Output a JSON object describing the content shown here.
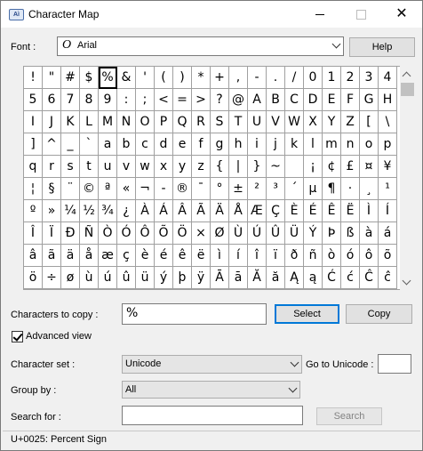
{
  "window": {
    "title": "Character Map",
    "icon": "character-map-app-icon",
    "icon_text": "Aì",
    "close_glyph": "✕"
  },
  "font": {
    "label": "Font :",
    "value": "Arial",
    "icon_glyph": "O"
  },
  "buttons": {
    "help": "Help",
    "select": "Select",
    "copy": "Copy",
    "search": "Search"
  },
  "characters": [
    "!",
    "\"",
    "#",
    "$",
    "%",
    "&",
    "'",
    "(",
    ")",
    "*",
    "+",
    ",",
    "-",
    ".",
    "/",
    "0",
    "1",
    "2",
    "3",
    "4",
    "5",
    "6",
    "7",
    "8",
    "9",
    ":",
    ";",
    "<",
    "=",
    ">",
    "?",
    "@",
    "A",
    "B",
    "C",
    "D",
    "E",
    "F",
    "G",
    "H",
    "I",
    "J",
    "K",
    "L",
    "M",
    "N",
    "O",
    "P",
    "Q",
    "R",
    "S",
    "T",
    "U",
    "V",
    "W",
    "X",
    "Y",
    "Z",
    "[",
    "\\",
    "]",
    "^",
    "_",
    "`",
    "a",
    "b",
    "c",
    "d",
    "e",
    "f",
    "g",
    "h",
    "i",
    "j",
    "k",
    "l",
    "m",
    "n",
    "o",
    "p",
    "q",
    "r",
    "s",
    "t",
    "u",
    "v",
    "w",
    "x",
    "y",
    "z",
    "{",
    "|",
    "}",
    "~",
    " ",
    "¡",
    "¢",
    "£",
    "¤",
    "¥",
    "¦",
    "§",
    "¨",
    "©",
    "ª",
    "«",
    "¬",
    "-",
    "®",
    "¯",
    "°",
    "±",
    "²",
    "³",
    "´",
    "µ",
    "¶",
    "·",
    "¸",
    "¹",
    "º",
    "»",
    "¼",
    "½",
    "¾",
    "¿",
    "À",
    "Á",
    "Â",
    "Ã",
    "Ä",
    "Å",
    "Æ",
    "Ç",
    "È",
    "É",
    "Ê",
    "Ë",
    "Ì",
    "Í",
    "Î",
    "Ï",
    "Ð",
    "Ñ",
    "Ò",
    "Ó",
    "Ô",
    "Õ",
    "Ö",
    "×",
    "Ø",
    "Ù",
    "Ú",
    "Û",
    "Ü",
    "Ý",
    "Þ",
    "ß",
    "à",
    "á",
    "â",
    "ã",
    "ä",
    "å",
    "æ",
    "ç",
    "è",
    "é",
    "ê",
    "ë",
    "ì",
    "í",
    "î",
    "ï",
    "ð",
    "ñ",
    "ò",
    "ó",
    "ô",
    "õ",
    "ö",
    "÷",
    "ø",
    "ù",
    "ú",
    "û",
    "ü",
    "ý",
    "þ",
    "ÿ",
    "Ā",
    "ā",
    "Ă",
    "ă",
    "Ą",
    "ą",
    "Ć",
    "ć",
    "Ĉ",
    "ĉ"
  ],
  "selected_character": "%",
  "copy": {
    "label": "Characters to copy :",
    "value": "%"
  },
  "advanced_view": {
    "label": "Advanced view",
    "checked": true
  },
  "character_set": {
    "label": "Character set :",
    "value": "Unicode"
  },
  "goto_unicode": {
    "label": "Go to Unicode :",
    "value": ""
  },
  "group_by": {
    "label": "Group by :",
    "value": "All"
  },
  "search": {
    "label": "Search for :",
    "value": ""
  },
  "status": "U+0025: Percent Sign"
}
